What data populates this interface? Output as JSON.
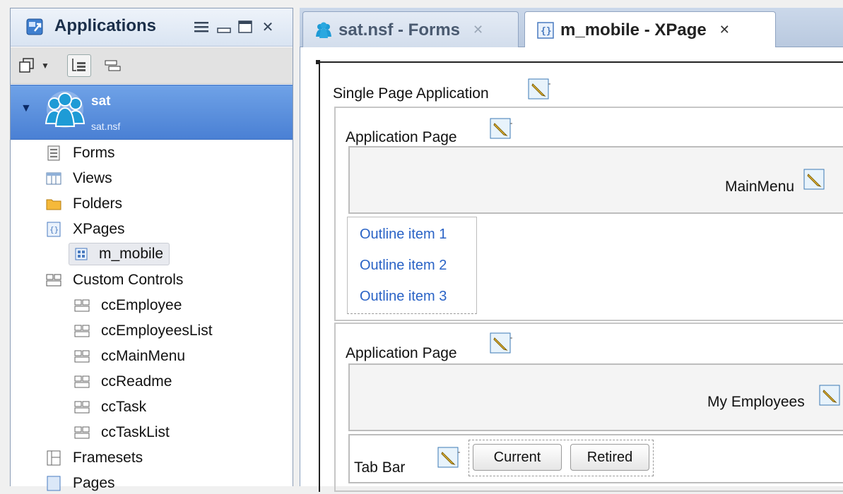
{
  "left_panel": {
    "title": "Applications",
    "window_controls": [
      "menu-icon",
      "minimize-icon",
      "maximize-icon",
      "close-icon"
    ],
    "toolbar": [
      "new-app-icon",
      "dropdown-arrow-icon",
      "tree-view-icon",
      "list-view-icon"
    ],
    "tree": {
      "root": {
        "name": "sat",
        "file": "sat.nsf"
      },
      "items": [
        {
          "label": "Forms",
          "icon": "form-icon",
          "level": 1
        },
        {
          "label": "Views",
          "icon": "view-icon",
          "level": 1
        },
        {
          "label": "Folders",
          "icon": "folder-icon",
          "level": 1
        },
        {
          "label": "XPages",
          "icon": "xpage-icon",
          "level": 1
        },
        {
          "label": "m_mobile",
          "icon": "xpage-icon",
          "level": 2,
          "selected": true
        },
        {
          "label": "Custom Controls",
          "icon": "custom-control-icon",
          "level": 1
        },
        {
          "label": "ccEmployee",
          "icon": "custom-control-icon",
          "level": 2
        },
        {
          "label": "ccEmployeesList",
          "icon": "custom-control-icon",
          "level": 2
        },
        {
          "label": "ccMainMenu",
          "icon": "custom-control-icon",
          "level": 2
        },
        {
          "label": "ccReadme",
          "icon": "custom-control-icon",
          "level": 2
        },
        {
          "label": "ccTask",
          "icon": "custom-control-icon",
          "level": 2
        },
        {
          "label": "ccTaskList",
          "icon": "custom-control-icon",
          "level": 2
        },
        {
          "label": "Framesets",
          "icon": "frameset-icon",
          "level": 1
        },
        {
          "label": "Pages",
          "icon": "page-icon",
          "level": 1
        }
      ]
    }
  },
  "tabs": [
    {
      "label": "sat.nsf - Forms",
      "icon": "app-icon",
      "active": false
    },
    {
      "label": "m_mobile - XPage",
      "icon": "xpage-icon",
      "active": true
    }
  ],
  "design": {
    "single_page_app_label": "Single Page Application",
    "page1": {
      "label": "Application Page",
      "heading_label": "MainMenu",
      "outline_items": [
        "Outline item 1",
        "Outline item 2",
        "Outline item 3"
      ]
    },
    "page2": {
      "label": "Application Page",
      "heading_label": "My Employees",
      "tab_bar_label": "Tab Bar",
      "tab_buttons": [
        "Current",
        "Retired"
      ]
    }
  },
  "colors": {
    "selection": "#4a80d4",
    "link": "#2a63c6",
    "tab_strip": "#c4d3e7"
  }
}
